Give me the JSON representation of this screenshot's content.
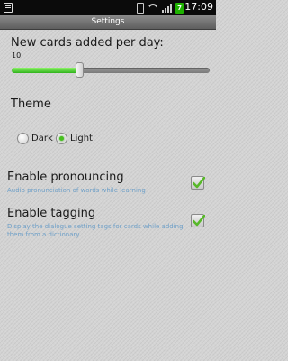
{
  "status_bar": {
    "battery_level": "7",
    "time": "17:09"
  },
  "title_bar": {
    "title": "Settings"
  },
  "cards_per_day": {
    "label": "New cards added per day:",
    "value": "10",
    "slider_fraction": 0.34
  },
  "theme": {
    "heading": "Theme",
    "options": [
      {
        "label": "Dark",
        "selected": false
      },
      {
        "label": "Light",
        "selected": true
      }
    ]
  },
  "pronouncing": {
    "title": "Enable pronouncing",
    "description": "Audio pronunciation of words while learning",
    "checked": true
  },
  "tagging": {
    "title": "Enable tagging",
    "description": "Display the dialogue setting tags for cards while adding them from a dictionary.",
    "checked": true
  },
  "colors": {
    "accent_green": "#46c01e",
    "description_blue": "#6fa0c8",
    "check_green": "#57b829"
  }
}
